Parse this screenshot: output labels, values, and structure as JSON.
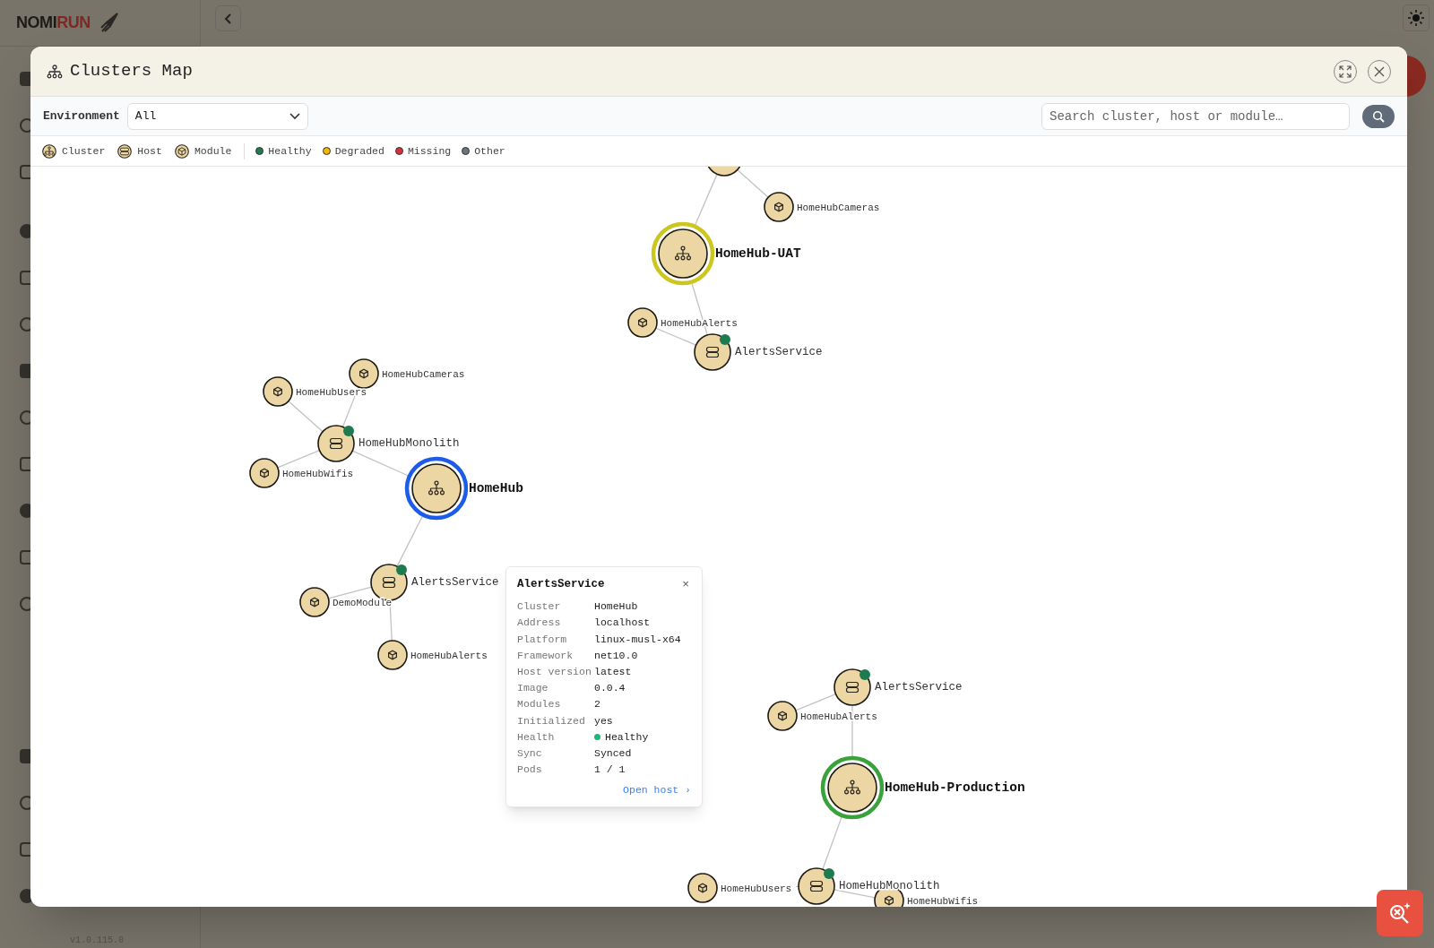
{
  "app": {
    "logo_dark": "NOMI",
    "logo_red": "RUN",
    "version": "v1.0.115.0"
  },
  "modal": {
    "title": "Clusters Map",
    "environment_label": "Environment",
    "environment_value": "All",
    "search_placeholder": "Search cluster, host or module…"
  },
  "legend": {
    "types": [
      {
        "kind": "cluster",
        "label": "Cluster"
      },
      {
        "kind": "host",
        "label": "Host"
      },
      {
        "kind": "module",
        "label": "Module"
      }
    ],
    "statuses": [
      {
        "label": "Healthy",
        "color": "#1e7a4f"
      },
      {
        "label": "Degraded",
        "color": "#f2b705"
      },
      {
        "label": "Missing",
        "color": "#d9303e"
      },
      {
        "label": "Other",
        "color": "#6b7280"
      }
    ]
  },
  "clusters": [
    {
      "label": "HomeHub-UAT",
      "color": "#cdc61e",
      "hosts": [
        {
          "modules": [
            {
              "label": "HomeHubCameras"
            }
          ]
        },
        {
          "label": "AlertsService",
          "color": "#1e7a4f",
          "modules": [
            {
              "label": "HomeHubAlerts"
            }
          ]
        }
      ]
    },
    {
      "label": "HomeHub",
      "color": "#1c5ce8",
      "hosts": [
        {
          "label": "HomeHubMonolith",
          "color": "#1e7a4f",
          "modules": [
            {
              "label": "HomeHubCameras"
            },
            {
              "label": "HomeHubUsers"
            },
            {
              "label": "HomeHubWifis"
            }
          ]
        },
        {
          "label": "AlertsService",
          "color": "#1e7a4f",
          "modules": [
            {
              "label": "DemoModule"
            },
            {
              "label": "HomeHubAlerts"
            }
          ]
        }
      ]
    },
    {
      "label": "HomeHub-Production",
      "color": "#3aa23a",
      "hosts": [
        {
          "label": "AlertsService",
          "color": "#1e7a4f",
          "modules": [
            {
              "label": "HomeHubAlerts"
            }
          ]
        },
        {
          "label": "HomeHubMonolith",
          "color": "#1e7a4f",
          "modules": [
            {
              "label": "HomeHubUsers"
            },
            {
              "label": "HomeHubWifis"
            }
          ]
        }
      ]
    }
  ],
  "tooltip": {
    "title": "AlertsService",
    "close": "×",
    "rows": [
      {
        "label": "Cluster",
        "value": "HomeHub"
      },
      {
        "label": "Address",
        "value": "localhost"
      },
      {
        "label": "Platform",
        "value": "linux-musl-x64"
      },
      {
        "label": "Framework",
        "value": "net10.0"
      },
      {
        "label": "Host version",
        "value": "latest"
      },
      {
        "label": "Image",
        "value": "0.0.4"
      },
      {
        "label": "Modules",
        "value": "2"
      },
      {
        "label": "Initialized",
        "value": "yes"
      },
      {
        "label": "Health",
        "value": "Healthy",
        "color": "#22b573"
      },
      {
        "label": "Sync",
        "value": "Synced"
      },
      {
        "label": "Pods",
        "value": "1 / 1"
      }
    ],
    "link": "Open host ›"
  }
}
